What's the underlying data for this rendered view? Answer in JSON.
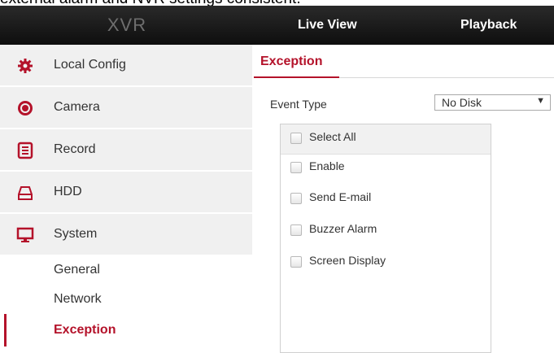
{
  "caption": "external alarm and NVR settings consistent.",
  "header": {
    "logo": "XVR",
    "nav": {
      "live_view": "Live View",
      "playback": "Playback"
    }
  },
  "sidebar": {
    "items": [
      {
        "label": "Local Config",
        "icon": "gear-icon"
      },
      {
        "label": "Camera",
        "icon": "camera-icon"
      },
      {
        "label": "Record",
        "icon": "record-icon"
      },
      {
        "label": "HDD",
        "icon": "hdd-icon"
      },
      {
        "label": "System",
        "icon": "monitor-icon"
      }
    ],
    "sub_items": [
      {
        "label": "General"
      },
      {
        "label": "Network"
      },
      {
        "label": "Exception",
        "active": true
      }
    ]
  },
  "main": {
    "tab_title": "Exception",
    "event_type_label": "Event Type",
    "event_type_value": "No Disk",
    "options": {
      "select_all": "Select All",
      "enable": "Enable",
      "send_email": "Send E-mail",
      "buzzer_alarm": "Buzzer Alarm",
      "screen_display": "Screen Display"
    }
  },
  "colors": {
    "accent": "#b4122a",
    "header_bg": "#161616",
    "sidebar_bg": "#f0f0f0"
  }
}
